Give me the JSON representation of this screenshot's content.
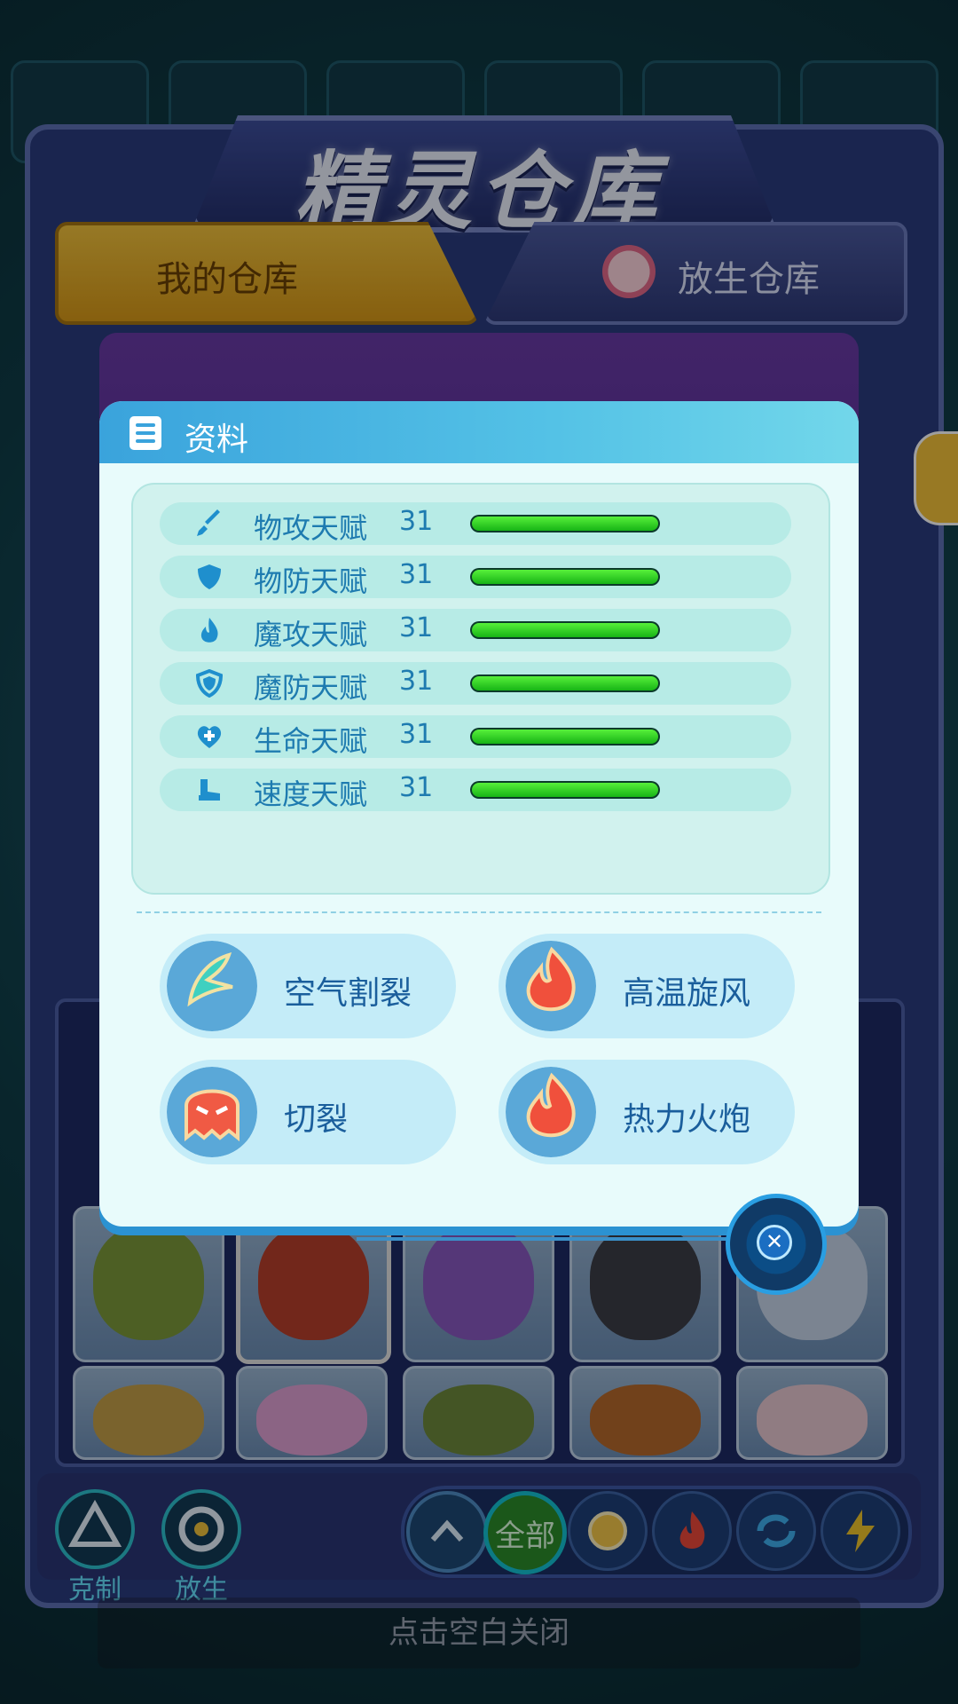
{
  "header": {
    "title": "精灵仓库",
    "tab_my": "我的仓库",
    "tab_release": "放生仓库"
  },
  "dialog": {
    "title": "资料",
    "talents": [
      {
        "label": "物攻天赋",
        "value": "31",
        "icon": "sword-icon",
        "fill": 1.0
      },
      {
        "label": "物防天赋",
        "value": "31",
        "icon": "shield-icon",
        "fill": 1.0
      },
      {
        "label": "魔攻天赋",
        "value": "31",
        "icon": "flame-icon",
        "fill": 1.0
      },
      {
        "label": "魔防天赋",
        "value": "31",
        "icon": "magic-shield-icon",
        "fill": 1.0
      },
      {
        "label": "生命天赋",
        "value": "31",
        "icon": "heart-plus-icon",
        "fill": 1.0
      },
      {
        "label": "速度天赋",
        "value": "31",
        "icon": "boot-icon",
        "fill": 1.0
      }
    ],
    "skills": [
      {
        "label": "空气割裂",
        "icon": "wind-wing-icon"
      },
      {
        "label": "高温旋风",
        "icon": "fire-icon"
      },
      {
        "label": "切裂",
        "icon": "ghost-icon"
      },
      {
        "label": "热力火炮",
        "icon": "fire-icon"
      }
    ],
    "close_icon": "close-icon"
  },
  "bottom": {
    "counter_label": "克制",
    "release_label": "放生",
    "filter_all": "全部",
    "hint": "点击空白关闭"
  },
  "colors": {
    "accent": "#3aa3dc",
    "bar_fill": "#17b416",
    "tab_active": "#f3c33d"
  }
}
